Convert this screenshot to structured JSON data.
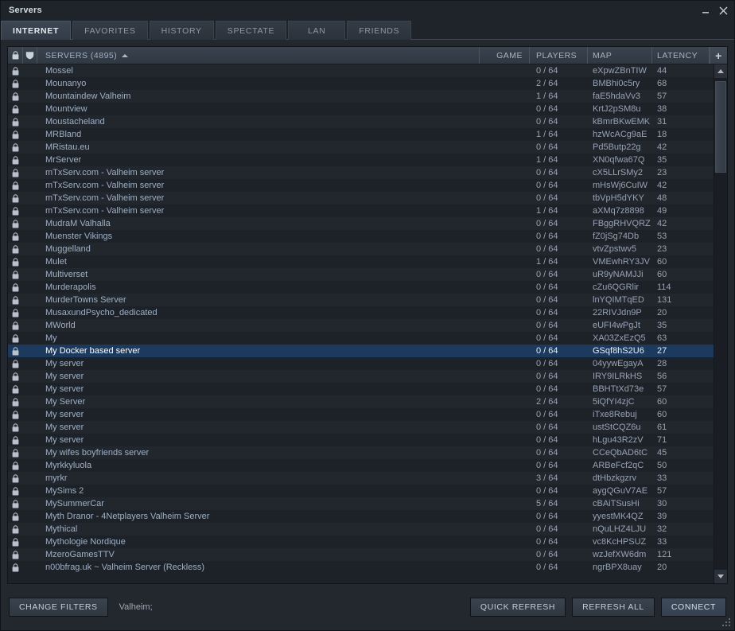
{
  "window": {
    "title": "Servers",
    "minimize_label": "—",
    "close_label": "✕"
  },
  "tabs": [
    {
      "label": "INTERNET",
      "active": true
    },
    {
      "label": "FAVORITES",
      "active": false
    },
    {
      "label": "HISTORY",
      "active": false
    },
    {
      "label": "SPECTATE",
      "active": false
    },
    {
      "label": "LAN",
      "active": false
    },
    {
      "label": "FRIENDS",
      "active": false
    }
  ],
  "columns": {
    "lock_icon": "lock-icon",
    "favorite_icon": "shield-icon",
    "servers": "SERVERS (4895)",
    "game": "GAME",
    "players": "PLAYERS",
    "map": "MAP",
    "latency": "LATENCY",
    "add_column": "+",
    "sort": "ascending"
  },
  "rows": [
    {
      "name": "Mossel",
      "game": "",
      "players": "0 / 64",
      "map": "eXpwZBnTIW",
      "latency": "44",
      "selected": false
    },
    {
      "name": "Mounanyo",
      "game": "",
      "players": "2 / 64",
      "map": "BMBhi0c5ry",
      "latency": "68",
      "selected": false
    },
    {
      "name": "Mountaindew Valheim",
      "game": "",
      "players": "1 / 64",
      "map": "faE5hdaVv3",
      "latency": "57",
      "selected": false
    },
    {
      "name": "Mountview",
      "game": "",
      "players": "0 / 64",
      "map": "KrtJ2pSM8u",
      "latency": "38",
      "selected": false
    },
    {
      "name": "Moustacheland",
      "game": "",
      "players": "0 / 64",
      "map": "kBmrBKwEMK",
      "latency": "31",
      "selected": false
    },
    {
      "name": "MRBland",
      "game": "",
      "players": "1 / 64",
      "map": "hzWcACg9aE",
      "latency": "18",
      "selected": false
    },
    {
      "name": "MRistau.eu",
      "game": "",
      "players": "0 / 64",
      "map": "Pd5Butp22g",
      "latency": "42",
      "selected": false
    },
    {
      "name": "MrServer",
      "game": "",
      "players": "1 / 64",
      "map": "XN0qfwa67Q",
      "latency": "35",
      "selected": false
    },
    {
      "name": "mTxServ.com - Valheim server",
      "game": "",
      "players": "0 / 64",
      "map": "cX5LLrSMy2",
      "latency": "23",
      "selected": false
    },
    {
      "name": "mTxServ.com - Valheim server",
      "game": "",
      "players": "0 / 64",
      "map": "mHsWj6CuIW",
      "latency": "42",
      "selected": false
    },
    {
      "name": "mTxServ.com - Valheim server",
      "game": "",
      "players": "0 / 64",
      "map": "tbVpH5dYKY",
      "latency": "48",
      "selected": false
    },
    {
      "name": "mTxServ.com - Valheim server",
      "game": "",
      "players": "1 / 64",
      "map": "aXMq7z8898",
      "latency": "49",
      "selected": false
    },
    {
      "name": "MudraM Valhalla",
      "game": "",
      "players": "0 / 64",
      "map": "FBggRHVQRZ",
      "latency": "42",
      "selected": false
    },
    {
      "name": "Muenster Vikings",
      "game": "",
      "players": "0 / 64",
      "map": "fZ0jSg74Db",
      "latency": "53",
      "selected": false
    },
    {
      "name": "Muggelland",
      "game": "",
      "players": "0 / 64",
      "map": "vtvZpstwv5",
      "latency": "23",
      "selected": false
    },
    {
      "name": "Mulet",
      "game": "",
      "players": "1 / 64",
      "map": "VMEwhRY3JV",
      "latency": "60",
      "selected": false
    },
    {
      "name": "Multiverset",
      "game": "",
      "players": "0 / 64",
      "map": "uR9yNAMJJi",
      "latency": "60",
      "selected": false
    },
    {
      "name": "Murderapolis",
      "game": "",
      "players": "0 / 64",
      "map": "cZu6QGRlir",
      "latency": "114",
      "selected": false
    },
    {
      "name": "MurderTowns Server",
      "game": "",
      "players": "0 / 64",
      "map": "lnYQIMTqED",
      "latency": "131",
      "selected": false
    },
    {
      "name": "MusaxundPsycho_dedicated",
      "game": "",
      "players": "0 / 64",
      "map": "22RIVJdn9P",
      "latency": "20",
      "selected": false
    },
    {
      "name": "MWorld",
      "game": "",
      "players": "0 / 64",
      "map": "eUFI4wPgJt",
      "latency": "35",
      "selected": false
    },
    {
      "name": "My",
      "game": "",
      "players": "0 / 64",
      "map": "XA03ZxEzQ5",
      "latency": "63",
      "selected": false
    },
    {
      "name": "My Docker based server",
      "game": "",
      "players": "0 / 64",
      "map": "GSqf8hS2U6",
      "latency": "27",
      "selected": true
    },
    {
      "name": "My server",
      "game": "",
      "players": "0 / 64",
      "map": "04yywEgayA",
      "latency": "28",
      "selected": false
    },
    {
      "name": "My server",
      "game": "",
      "players": "0 / 64",
      "map": "IRY9ILRkHS",
      "latency": "56",
      "selected": false
    },
    {
      "name": "My server",
      "game": "",
      "players": "0 / 64",
      "map": "BBHTtXd73e",
      "latency": "57",
      "selected": false
    },
    {
      "name": "My Server",
      "game": "",
      "players": "2 / 64",
      "map": "5iQfYI4zjC",
      "latency": "60",
      "selected": false
    },
    {
      "name": "My server",
      "game": "",
      "players": "0 / 64",
      "map": "iTxe8Rebuj",
      "latency": "60",
      "selected": false
    },
    {
      "name": "My server",
      "game": "",
      "players": "0 / 64",
      "map": "ustStCQZ6u",
      "latency": "61",
      "selected": false
    },
    {
      "name": "My server",
      "game": "",
      "players": "0 / 64",
      "map": "hLgu43R2zV",
      "latency": "71",
      "selected": false
    },
    {
      "name": "My wifes boyfriends server",
      "game": "",
      "players": "0 / 64",
      "map": "CCeQbAD6tC",
      "latency": "45",
      "selected": false
    },
    {
      "name": "Myrkkyluola",
      "game": "",
      "players": "0 / 64",
      "map": "ARBeFcf2qC",
      "latency": "50",
      "selected": false
    },
    {
      "name": "myrkr",
      "game": "",
      "players": "3 / 64",
      "map": "dtHbzkgzrv",
      "latency": "33",
      "selected": false
    },
    {
      "name": "MySims 2",
      "game": "",
      "players": "0 / 64",
      "map": "aygQGuV7AE",
      "latency": "57",
      "selected": false
    },
    {
      "name": "MySummerCar",
      "game": "",
      "players": "5 / 64",
      "map": "cBAiTSusHi",
      "latency": "30",
      "selected": false
    },
    {
      "name": "Myth Dranor - 4Netplayers Valheim Server",
      "game": "",
      "players": "0 / 64",
      "map": "yyestMK4QZ",
      "latency": "39",
      "selected": false
    },
    {
      "name": "Mythical",
      "game": "",
      "players": "0 / 64",
      "map": "nQuLHZ4LJU",
      "latency": "32",
      "selected": false
    },
    {
      "name": "Mythologie Nordique",
      "game": "",
      "players": "0 / 64",
      "map": "vc8KcHPSUZ",
      "latency": "33",
      "selected": false
    },
    {
      "name": "MzeroGamesTTV",
      "game": "",
      "players": "0 / 64",
      "map": "wzJefXW6dm",
      "latency": "121",
      "selected": false
    },
    {
      "name": "n00bfrag.uk ~ Valheim Server (Reckless)",
      "game": "",
      "players": "0 / 64",
      "map": "ngrBPX8uay",
      "latency": "20",
      "selected": false
    }
  ],
  "scrollbar": {
    "up_arrow": "scroll-up-arrow",
    "down_arrow": "scroll-down-arrow"
  },
  "bottom": {
    "change_filters": "CHANGE FILTERS",
    "filter_summary": "Valheim;",
    "quick_refresh": "QUICK REFRESH",
    "refresh_all": "REFRESH ALL",
    "connect": "CONNECT"
  },
  "colors": {
    "window_bg": "#23282f",
    "panel_bg": "#1d2128",
    "row_alt": "#22262d",
    "selection": "#1b3a5e",
    "text": "#97a3b4",
    "name_text": "#9fb0c4",
    "header_text": "#a9b2bd"
  }
}
